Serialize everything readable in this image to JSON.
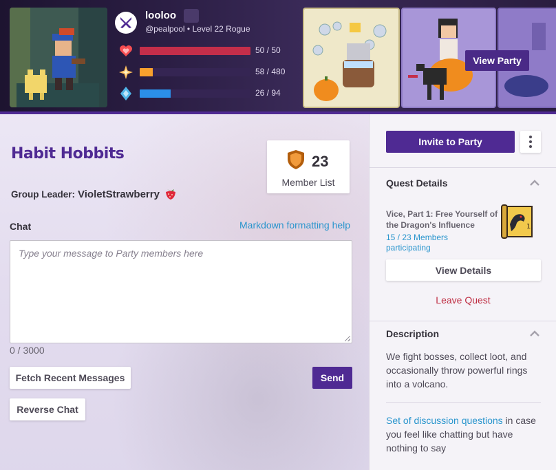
{
  "header": {
    "username": "looloo",
    "handle": "@pealpool",
    "level_text": "Level 22 Rogue",
    "stats": [
      {
        "name": "health",
        "icon": "heart-icon",
        "value_text": "50 / 50",
        "current": 50,
        "max": 50,
        "color": "#c42e4a"
      },
      {
        "name": "experience",
        "icon": "star-icon",
        "value_text": "58 / 480",
        "current": 58,
        "max": 480,
        "color": "#f8a12d"
      },
      {
        "name": "mana",
        "icon": "mana-crystal-icon",
        "value_text": "26 / 94",
        "current": 26,
        "max": 94,
        "color": "#2b8fe8"
      }
    ],
    "view_party_label": "View Party"
  },
  "group": {
    "title": "Habit Hobbits",
    "leader_label": "Group Leader:",
    "leader_name": "VioletStrawberry",
    "member_count": "23",
    "member_list_label": "Member List"
  },
  "chat": {
    "label": "Chat",
    "markdown_help": "Markdown formatting help",
    "placeholder": "Type your message to Party members here",
    "char_count": "0 / 3000",
    "fetch_label": "Fetch Recent Messages",
    "reverse_label": "Reverse Chat",
    "send_label": "Send"
  },
  "sidebar": {
    "invite_label": "Invite to Party",
    "quest_section_title": "Quest Details",
    "quest_name": "Vice, Part 1: Free Yourself of the Dragon's Influence",
    "quest_members": "15 / 23 Members participating",
    "view_details_label": "View Details",
    "leave_quest_label": "Leave Quest",
    "description_title": "Description",
    "description_text": "We fight bosses, collect loot, and occasionally throw powerful rings into a volcano.",
    "discussion_link": "Set of discussion questions",
    "discussion_rest": " in case you feel like chatting but have nothing to say"
  },
  "colors": {
    "brand_purple": "#4f2a93",
    "link_blue": "#2995cd",
    "danger_red": "#bf2e43"
  }
}
